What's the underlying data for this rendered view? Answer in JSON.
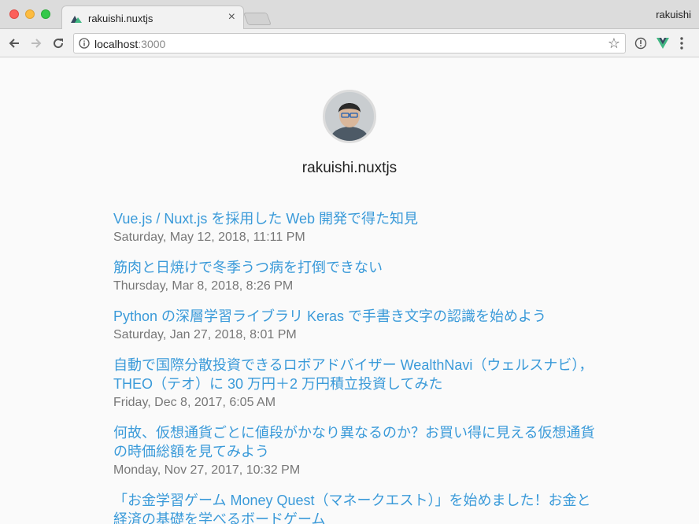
{
  "browser": {
    "tab_title": "rakuishi.nuxtjs",
    "tab_close": "×",
    "profile_name": "rakuishi",
    "url_host": "localhost",
    "url_port": ":3000",
    "star": "☆"
  },
  "site": {
    "title": "rakuishi.nuxtjs"
  },
  "posts": [
    {
      "title": "Vue.js / Nuxt.js を採用した Web 開発で得た知見",
      "date": "Saturday, May 12, 2018, 11:11 PM"
    },
    {
      "title": "筋肉と日焼けで冬季うつ病を打倒できない",
      "date": "Thursday, Mar 8, 2018, 8:26 PM"
    },
    {
      "title": "Python の深層学習ライブラリ Keras で手書き文字の認識を始めよう",
      "date": "Saturday, Jan 27, 2018, 8:01 PM"
    },
    {
      "title": "自動で国際分散投資できるロボアドバイザー WealthNavi（ウェルスナビ），THEO（テオ）に 30 万円＋2 万円積立投資してみた",
      "date": "Friday, Dec 8, 2017, 6:05 AM"
    },
    {
      "title": "何故、仮想通貨ごとに値段がかなり異なるのか？お買い得に見える仮想通貨の時価総額を見てみよう",
      "date": "Monday, Nov 27, 2017, 10:32 PM"
    },
    {
      "title": "「お金学習ゲーム Money Quest（マネークエスト）」を始めました！お金と経済の基礎を学べるボードゲーム",
      "date": ""
    }
  ],
  "colors": {
    "link": "#3a9ad9",
    "date": "#777777",
    "vue_green": "#41b883",
    "vue_dark": "#35495e"
  },
  "icons": {
    "back": "arrow-left-icon",
    "forward": "arrow-right-icon",
    "reload": "reload-icon",
    "info": "info-icon",
    "star": "star-icon",
    "extension_info": "extension-info-icon",
    "vue_devtools": "vue-logo-icon",
    "menu": "kebab-menu-icon"
  }
}
